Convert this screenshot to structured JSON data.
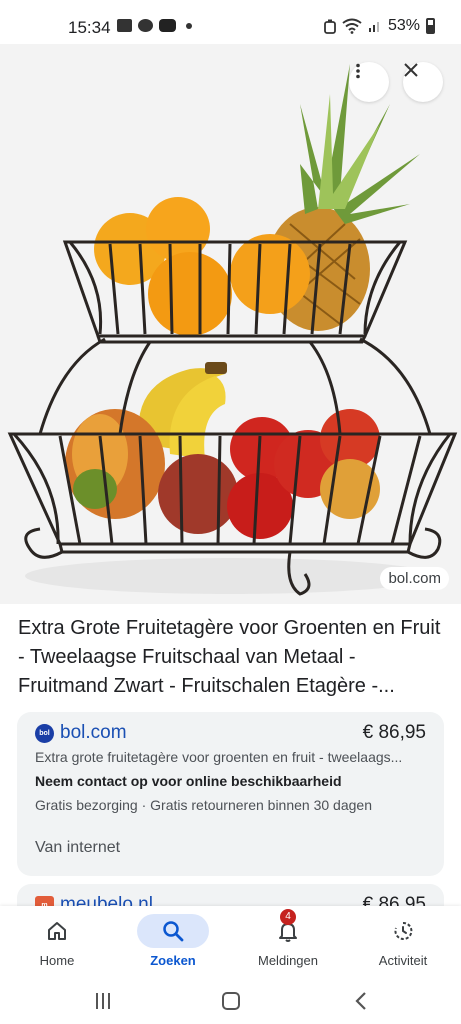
{
  "status_bar": {
    "time": "15:34",
    "battery": "53%",
    "icons": [
      "calendar-icon",
      "app-icon",
      "youtube-icon",
      "notification-dot-icon",
      "alarm-icon",
      "wifi-icon",
      "signal-icon",
      "battery-icon"
    ]
  },
  "hero": {
    "source_chip": "bol.com",
    "more_icon": "more-vert-icon",
    "close_icon": "close-icon"
  },
  "product": {
    "title": "Extra Grote Fruitetagère voor Groenten en Fruit - Tweelaagse Fruitschaal van Metaal - Fruitmand Zwart - Fruitschalen Etagère -..."
  },
  "offers": [
    {
      "store": "bol.com",
      "logo_text": "bol",
      "price": "€ 86,95",
      "description": "Extra grote fruitetagère voor groenten en fruit - tweelaags...",
      "contact": "Neem contact op voor online beschikbaarheid",
      "shipping": "Gratis bezorging · Gratis retourneren binnen 30 dagen",
      "source": "Van internet"
    },
    {
      "store": "meubelo.nl",
      "logo_text": "m",
      "price": "€ 86,95"
    }
  ],
  "bottom_nav": [
    {
      "label": "Home",
      "icon": "home-icon"
    },
    {
      "label": "Zoeken",
      "icon": "search-icon",
      "active": true
    },
    {
      "label": "Meldingen",
      "icon": "bell-icon",
      "badge": "4"
    },
    {
      "label": "Activiteit",
      "icon": "activity-icon"
    }
  ],
  "colors": {
    "accent": "#0b57d0",
    "store_link": "#1a4fb3",
    "card_bg": "#f1f3f4",
    "badge": "#c5221f"
  }
}
